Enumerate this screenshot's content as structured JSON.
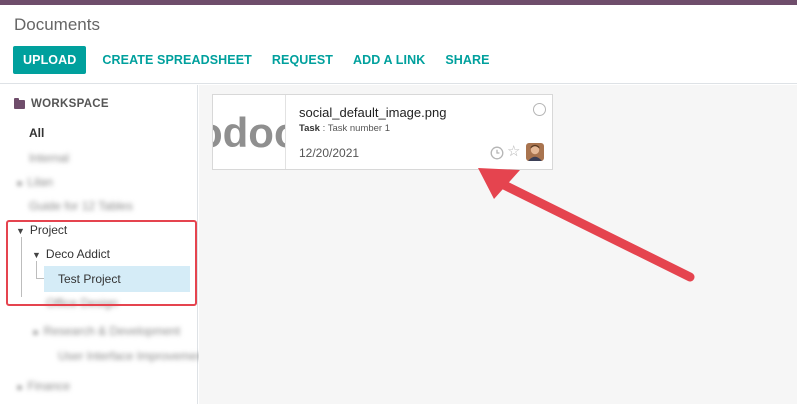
{
  "header": {
    "title": "Documents",
    "buttons": {
      "upload": "UPLOAD",
      "create_spreadsheet": "CREATE SPREADSHEET",
      "request": "REQUEST",
      "add_link": "ADD A LINK",
      "share": "SHARE"
    }
  },
  "sidebar": {
    "workspace_label": "WORKSPACE",
    "all_label": "All",
    "blurred_items": [
      "Internal",
      "Lilan",
      "Guide for 12 Tables",
      "Office Design",
      "Research & Development",
      "User Interface Improvements",
      "Finance"
    ],
    "tree": {
      "project": "Project",
      "deco_addict": "Deco Addict",
      "test_project": "Test Project"
    }
  },
  "document_card": {
    "file_name": "social_default_image.png",
    "meta_label": "Task",
    "meta_value": " : Task number 1",
    "date": "12/20/2021",
    "thumbnail_text": "odoo"
  },
  "colors": {
    "brand": "#6f4d6b",
    "accent": "#00a09d",
    "annotation": "#e5444f",
    "selected": "#d5ecf7"
  },
  "icons": {
    "workspace": "folder-icon",
    "status": "radio-icon",
    "activity": "clock-icon",
    "favorite": "star-icon",
    "owner": "avatar"
  }
}
